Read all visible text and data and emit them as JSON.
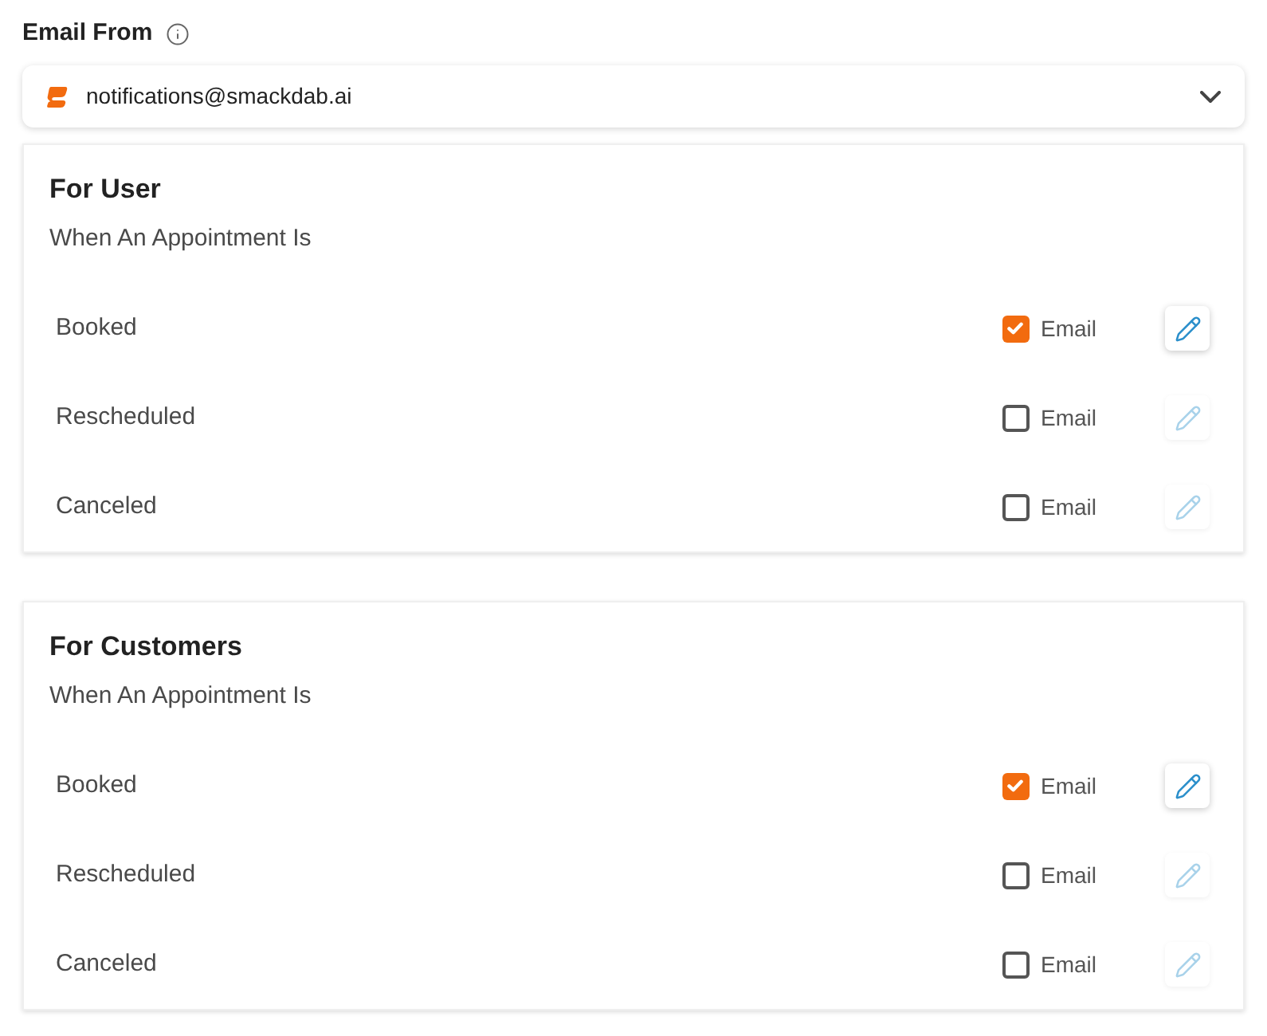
{
  "email_from": {
    "label": "Email From",
    "value": "notifications@smackdab.ai"
  },
  "sections": [
    {
      "title": "For User",
      "subtitle": "When An Appointment Is",
      "rows": [
        {
          "label": "Booked",
          "channel": "Email",
          "checked": true,
          "edit_disabled": false
        },
        {
          "label": "Rescheduled",
          "channel": "Email",
          "checked": false,
          "edit_disabled": true
        },
        {
          "label": "Canceled",
          "channel": "Email",
          "checked": false,
          "edit_disabled": true
        }
      ]
    },
    {
      "title": "For Customers",
      "subtitle": "When An Appointment Is",
      "rows": [
        {
          "label": "Booked",
          "channel": "Email",
          "checked": true,
          "edit_disabled": false
        },
        {
          "label": "Rescheduled",
          "channel": "Email",
          "checked": false,
          "edit_disabled": true
        },
        {
          "label": "Canceled",
          "channel": "Email",
          "checked": false,
          "edit_disabled": true
        }
      ]
    }
  ]
}
